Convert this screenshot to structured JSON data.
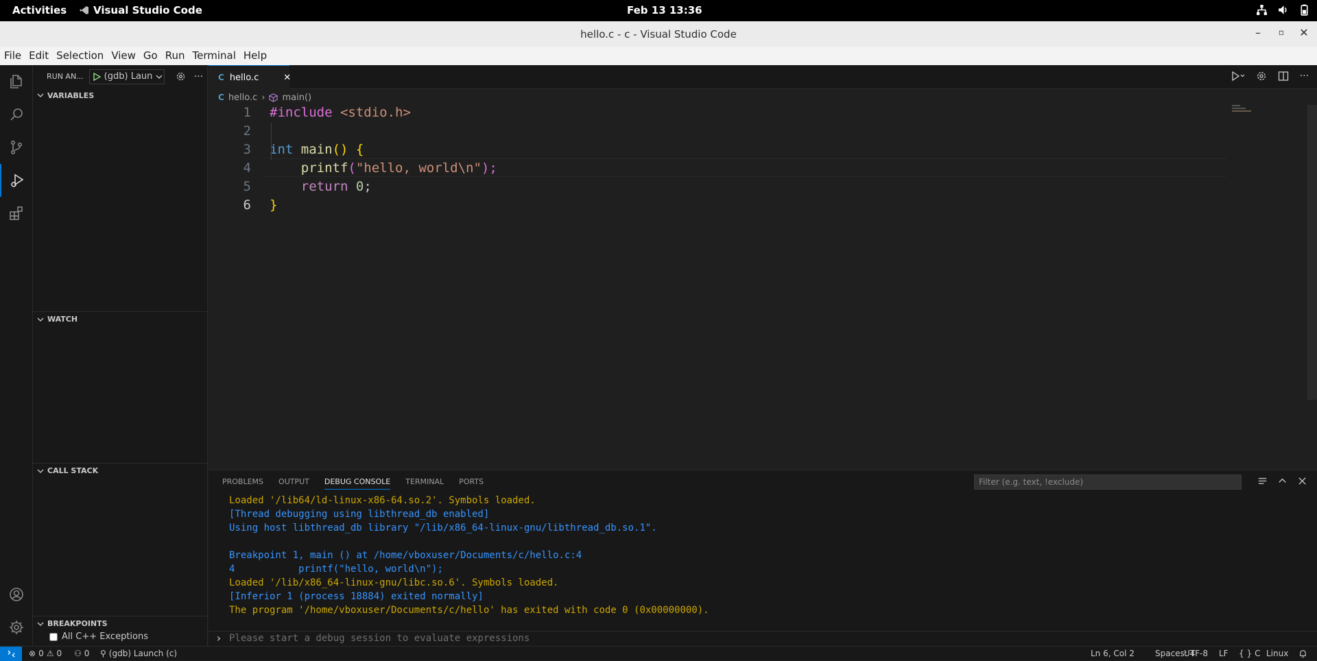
{
  "topbar": {
    "activities": "Activities",
    "app": "Visual Studio Code",
    "clock": "Feb 13  13:36"
  },
  "window": {
    "title": "hello.c - c - Visual Studio Code"
  },
  "menu": [
    "File",
    "Edit",
    "Selection",
    "View",
    "Go",
    "Run",
    "Terminal",
    "Help"
  ],
  "sidebar": {
    "title": "RUN AN...",
    "launch": "(gdb) Laun",
    "sections": {
      "variables": "VARIABLES",
      "watch": "WATCH",
      "callstack": "CALL STACK",
      "breakpoints": "BREAKPOINTS"
    },
    "breakpoint_item": "All C++ Exceptions"
  },
  "editor": {
    "tab": "hello.c",
    "tab_icon": "C",
    "breadcrumb_file": "hello.c",
    "breadcrumb_symbol": "main()",
    "line_numbers": [
      "1",
      "2",
      "3",
      "4",
      "5",
      "6"
    ],
    "code": {
      "l1_kw": "#include",
      "l1_hdr": "<stdio.h>",
      "l3_type": "int",
      "l3_fn": "main",
      "l3_paren": "()",
      "l3_brace": "{",
      "l4_fn": "printf",
      "l4_open": "(",
      "l4_str": "\"hello, world\\n\"",
      "l4_close": ");",
      "l5_kw": "return",
      "l5_num": "0",
      "l5_semi": ";",
      "l6_brace": "}"
    }
  },
  "panel": {
    "tabs": [
      "PROBLEMS",
      "OUTPUT",
      "DEBUG CONSOLE",
      "TERMINAL",
      "PORTS"
    ],
    "filter_placeholder": "Filter (e.g. text, !exclude)",
    "lines": [
      "Loaded '/lib64/ld-linux-x86-64.so.2'. Symbols loaded.",
      "[Thread debugging using libthread_db enabled]",
      "Using host libthread_db library \"/lib/x86_64-linux-gnu/libthread_db.so.1\".",
      "",
      "Breakpoint 1, main () at /home/vboxuser/Documents/c/hello.c:4",
      "4\t    printf(\"hello, world\\n\");",
      "Loaded '/lib/x86_64-linux-gnu/libc.so.6'. Symbols loaded.",
      "[Inferior 1 (process 18884) exited normally]",
      "The program '/home/vboxuser/Documents/c/hello' has exited with code 0 (0x00000000)."
    ],
    "eval_placeholder": "Please start a debug session to evaluate expressions"
  },
  "statusbar": {
    "errors": "0",
    "warnings": "0",
    "ports": "0",
    "launch": "(gdb) Launch (c)",
    "position": "Ln 6, Col 2",
    "spaces": "Spaces: 4",
    "encoding": "UTF-8",
    "eol": "LF",
    "language": "C",
    "platform": "Linux"
  }
}
